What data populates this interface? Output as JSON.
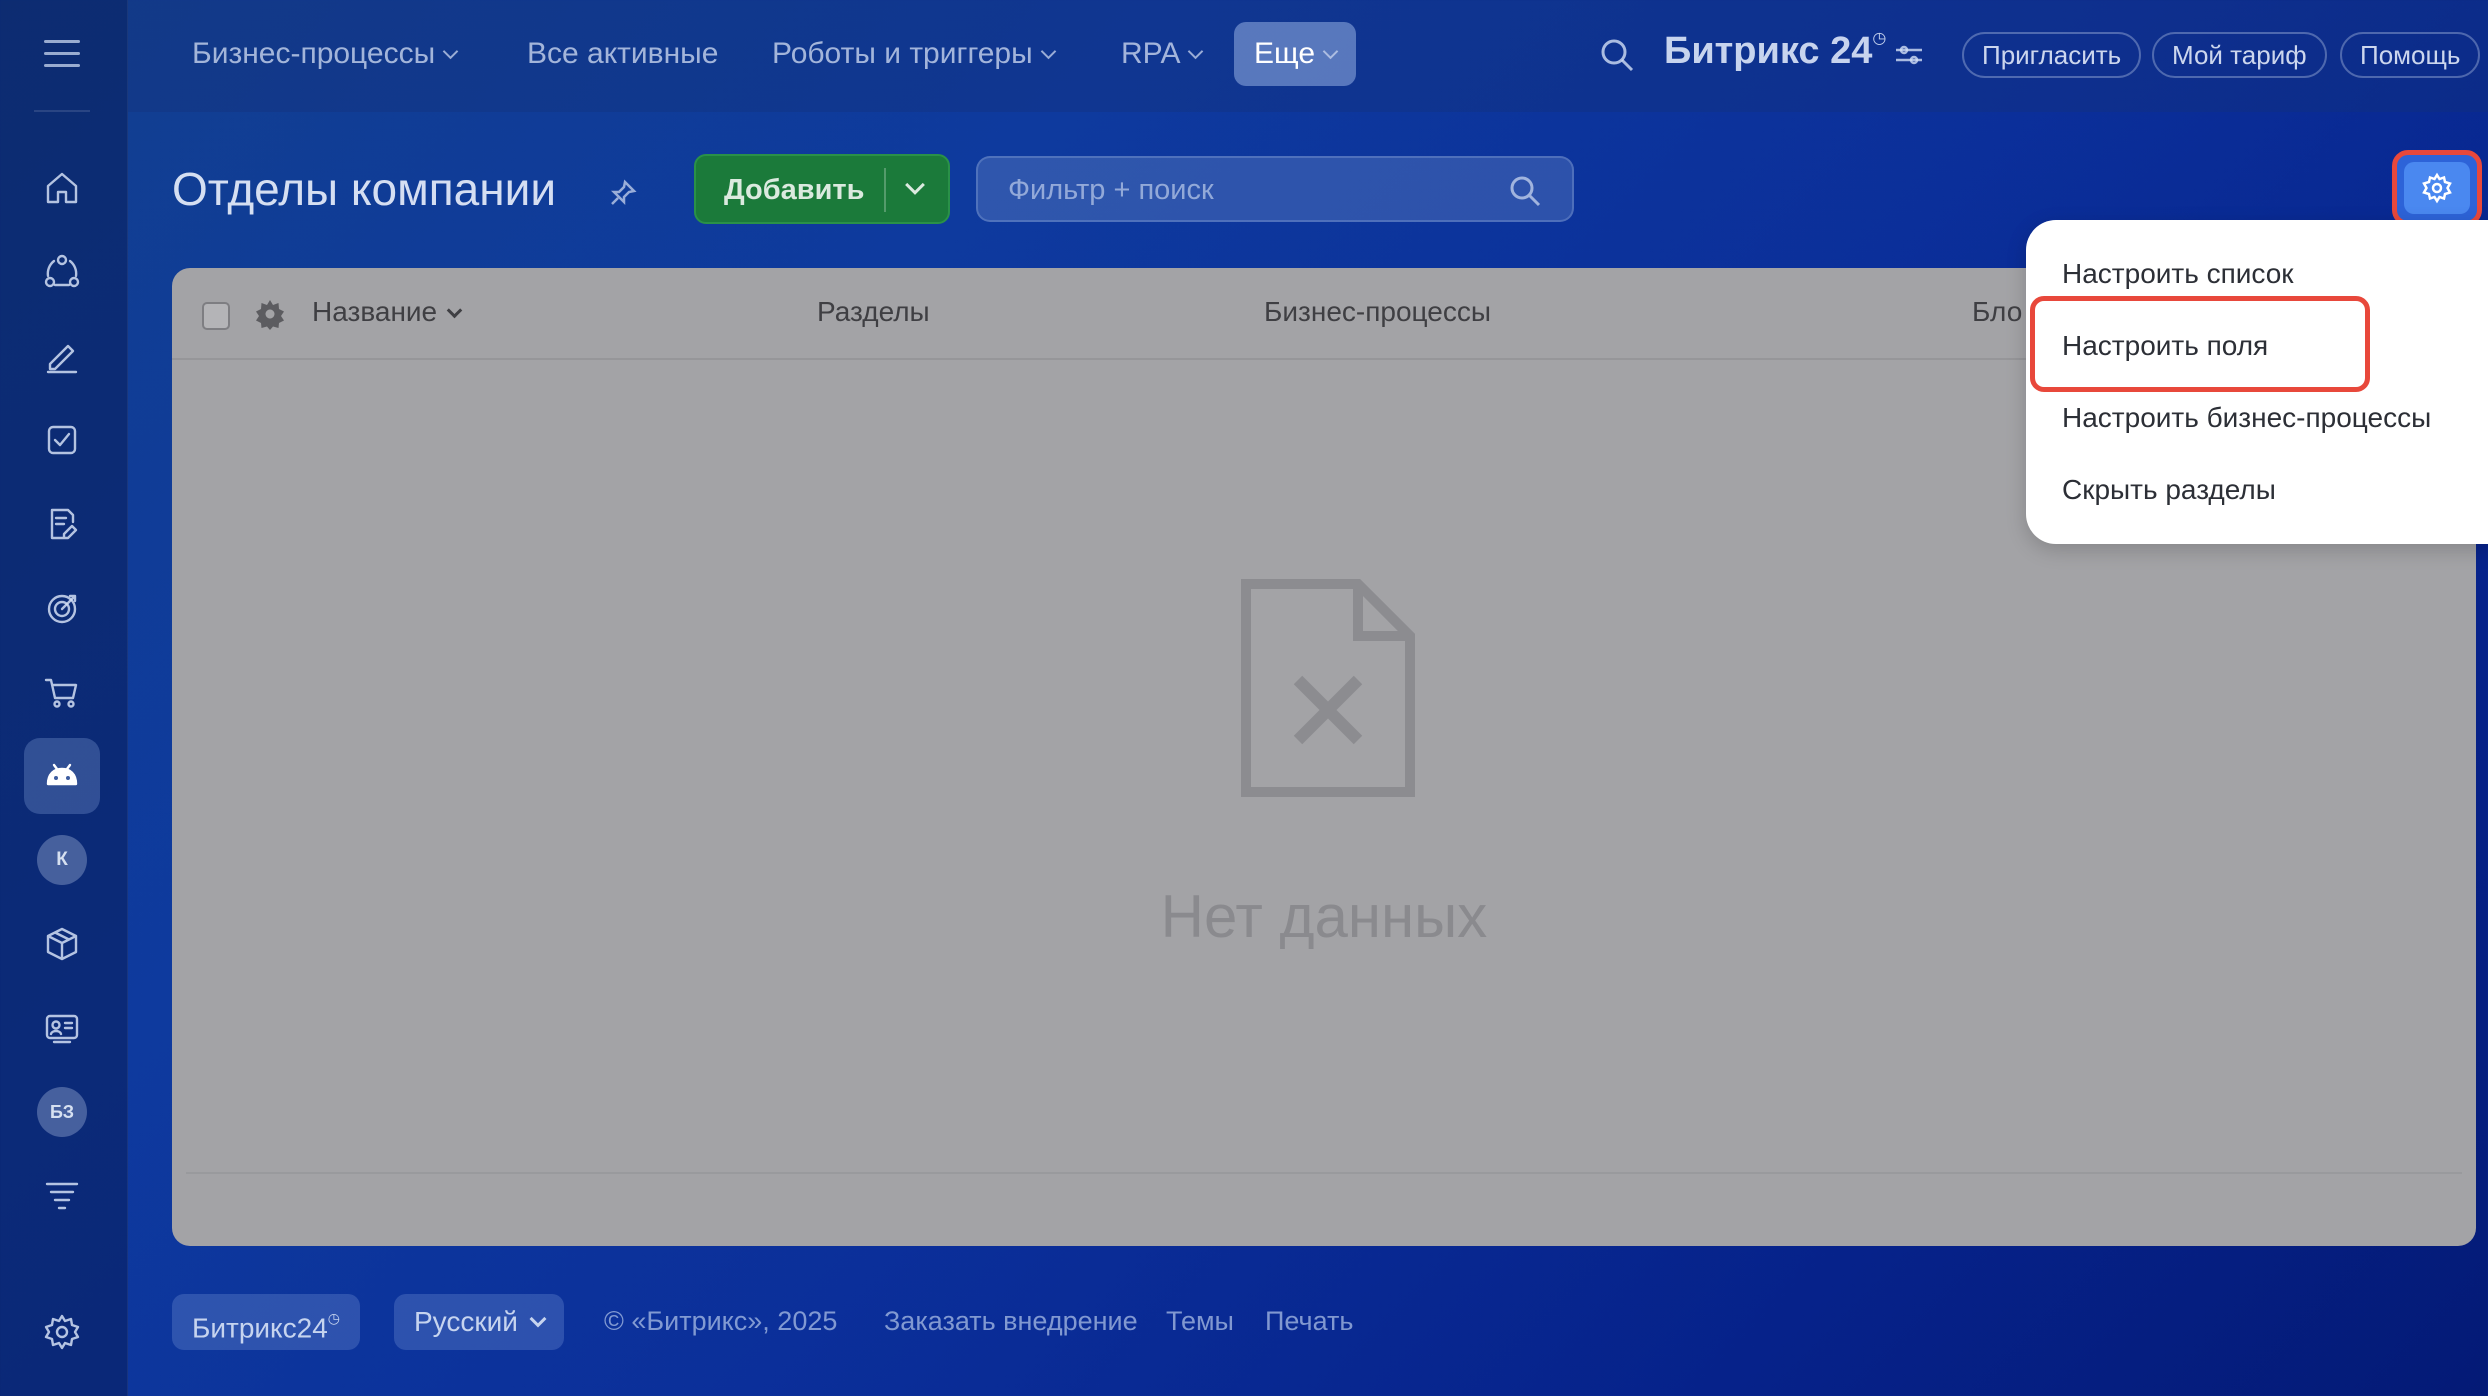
{
  "topbar": {
    "nav": [
      {
        "label": "Бизнес-процессы",
        "has_dropdown": true
      },
      {
        "label": "Все активные",
        "has_dropdown": false
      },
      {
        "label": "Роботы и триггеры",
        "has_dropdown": true
      },
      {
        "label": "RPA",
        "has_dropdown": true
      },
      {
        "label": "Еще",
        "has_dropdown": true,
        "active": true
      }
    ],
    "brand": "Битрикс 24",
    "brand_badge": "◷",
    "invite_label": "Пригласить",
    "tariff_label": "Мой тариф",
    "help_label": "Помощь"
  },
  "sidebar": {
    "items": [
      {
        "icon": "home-icon"
      },
      {
        "icon": "crm-icon"
      },
      {
        "icon": "sign-icon"
      },
      {
        "icon": "tasks-icon"
      },
      {
        "icon": "documents-icon"
      },
      {
        "icon": "goals-icon"
      },
      {
        "icon": "shop-icon"
      },
      {
        "icon": "automation-bot-icon",
        "active": true
      },
      {
        "badge": "К"
      },
      {
        "icon": "inventory-icon"
      },
      {
        "icon": "employees-icon"
      },
      {
        "badge": "БЗ"
      },
      {
        "icon": "funnel-icon"
      }
    ],
    "settings_icon": "gear-icon"
  },
  "page": {
    "title": "Отделы компании",
    "add_label": "Добавить",
    "filter_placeholder": "Фильтр + поиск"
  },
  "grid": {
    "columns": [
      "Название",
      "Разделы",
      "Бизнес-процессы",
      "Бло"
    ],
    "empty_text": "Нет данных"
  },
  "menu": {
    "items": [
      "Настроить список",
      "Настроить поля",
      "Настроить бизнес-процессы",
      "Скрыть разделы"
    ],
    "highlighted_index": 1
  },
  "footer": {
    "brand": "Битрикс24",
    "brand_badge": "◷",
    "language": "Русский",
    "copyright": "© «Битрикс», 2025",
    "links": [
      "Заказать внедрение",
      "Темы",
      "Печать"
    ]
  },
  "colors": {
    "accent_highlight": "#e8483b",
    "add_button": "#1b7a3a",
    "settings_button": "#4a88f0"
  }
}
